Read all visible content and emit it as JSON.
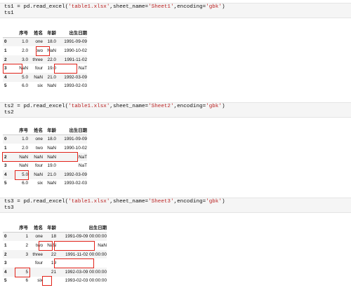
{
  "blocks": [
    {
      "code": {
        "line1_var": "ts1",
        "line1_mid": " = pd.read_excel(",
        "line1_file": "'table1.xlsx'",
        "line1_sheet_kw": ",sheet_name=",
        "line1_sheet": "'Sheet1'",
        "line1_enc_kw": ",encoding=",
        "line1_enc": "'gbk'",
        "line1_end": ")",
        "line2": "ts1"
      },
      "columns": [
        "",
        "序号",
        "姓名",
        "年龄",
        "出生日期"
      ],
      "rows": [
        [
          "0",
          "1.0",
          "one",
          "18.0",
          "1991-09-09"
        ],
        [
          "1",
          "2.0",
          "two",
          "NaN",
          "1990-10-02"
        ],
        [
          "2",
          "3.0",
          "three",
          "22.0",
          "1991-11-02"
        ],
        [
          "3",
          "NaN",
          "four",
          "19.0",
          "NaT"
        ],
        [
          "4",
          "5.0",
          "NaN",
          "21.0",
          "1992-03-09"
        ],
        [
          "5",
          "6.0",
          "six",
          "NaN",
          "1993-02-03"
        ]
      ]
    },
    {
      "code": {
        "line1_var": "ts2",
        "line1_mid": " = pd.read_excel(",
        "line1_file": "'table1.xlsx'",
        "line1_sheet_kw": ",sheet_name=",
        "line1_sheet": "'Sheet2'",
        "line1_enc_kw": ",encoding=",
        "line1_enc": "'gbk'",
        "line1_end": ")",
        "line2": "ts2"
      },
      "columns": [
        "",
        "序号",
        "姓名",
        "年龄",
        "出生日期"
      ],
      "rows": [
        [
          "0",
          "1.0",
          "one",
          "18.0",
          "1991-09-09"
        ],
        [
          "1",
          "2.0",
          "two",
          "NaN",
          "1990-10-02"
        ],
        [
          "2",
          "NaN",
          "NaN",
          "NaN",
          "NaT"
        ],
        [
          "3",
          "NaN",
          "four",
          "19.0",
          "NaT"
        ],
        [
          "4",
          "5.0",
          "NaN",
          "21.0",
          "1992-03-09"
        ],
        [
          "5",
          "6.0",
          "six",
          "NaN",
          "1993-02-03"
        ]
      ]
    },
    {
      "code": {
        "line1_var": "ts3",
        "line1_mid": " = pd.read_excel(",
        "line1_file": "'table1.xlsx'",
        "line1_sheet_kw": ",sheet_name=",
        "line1_sheet": "'Sheet3'",
        "line1_enc_kw": ",encoding=",
        "line1_enc": "'gbk'",
        "line1_end": ")",
        "line2": "ts3"
      },
      "columns": [
        "",
        "序号",
        "姓名",
        "年龄",
        "出生日期"
      ],
      "rows": [
        [
          "0",
          "1",
          "one",
          "18",
          "1991-09-09 00:00:00"
        ],
        [
          "1",
          "2",
          "two",
          "NaN",
          "NaN"
        ],
        [
          "2",
          "3",
          "three",
          "22",
          "1991-11-02 00:00:00"
        ],
        [
          "3",
          "",
          "four",
          "19",
          ""
        ],
        [
          "4",
          "5",
          "",
          "21",
          "1992-03-09 00:00:00"
        ],
        [
          "5",
          "6",
          "six",
          "",
          "1993-02-03 00:00:00"
        ]
      ]
    }
  ],
  "colors": {
    "highlight": "#e2231a",
    "string": "#ba2121",
    "cell_bg": "#f5f5f5"
  }
}
